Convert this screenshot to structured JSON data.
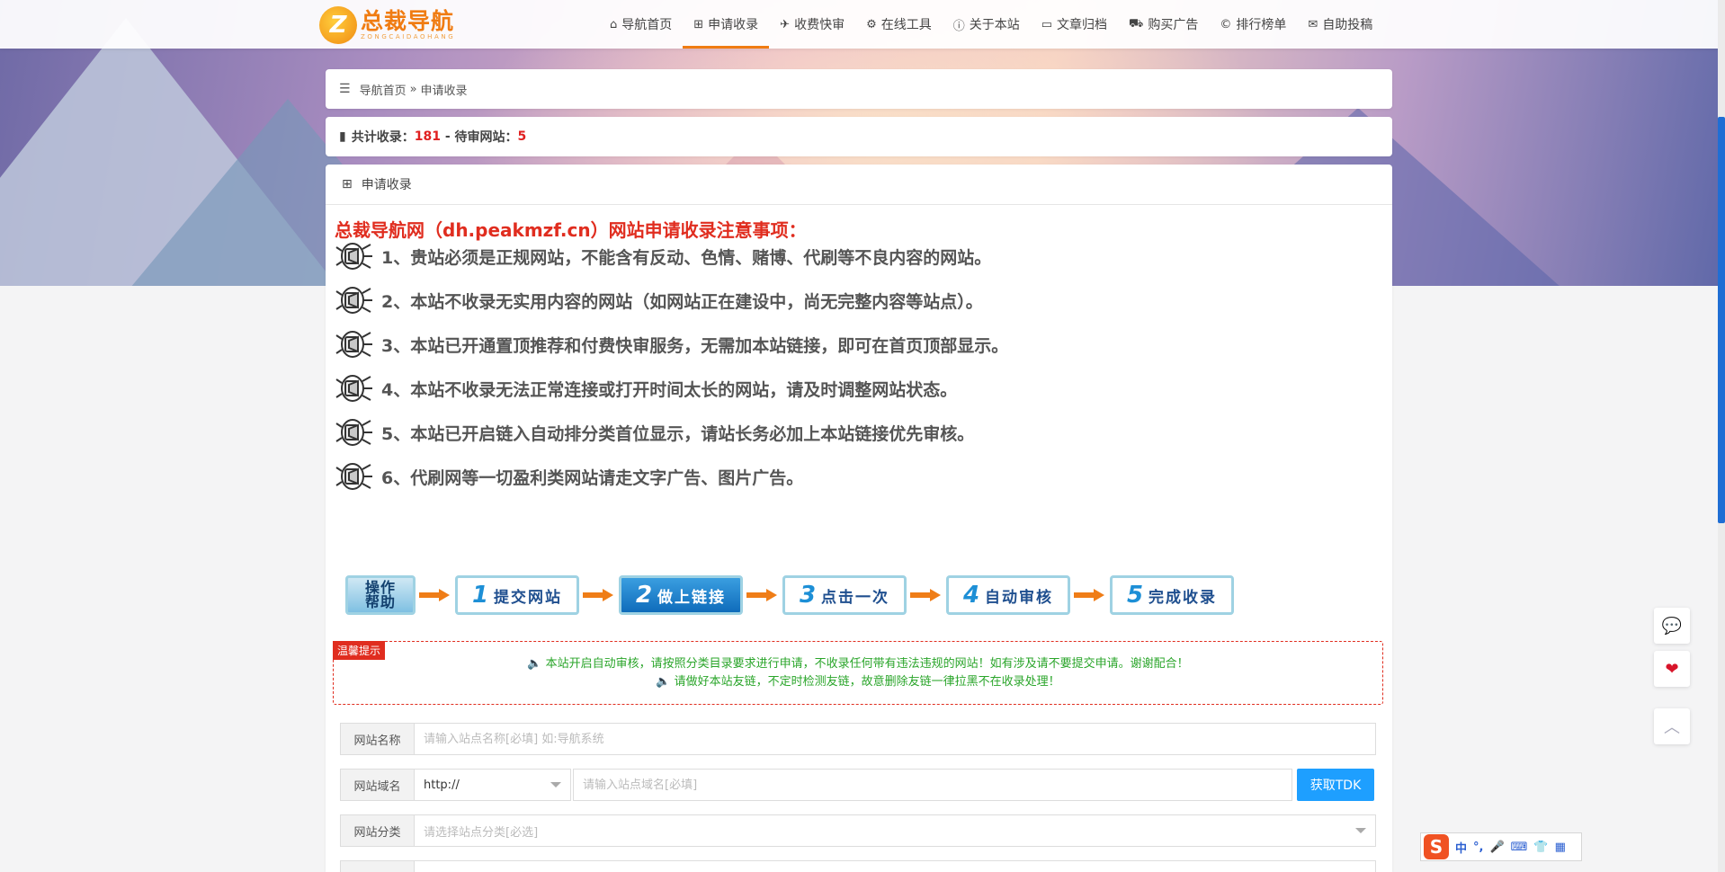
{
  "header": {
    "logo_text": "总裁导航",
    "logo_sub": "ZONGCAIDAOHANG",
    "logo_mark": "Z",
    "nav": [
      {
        "label": "导航首页",
        "icon": "⌂",
        "icon_name": "home-icon"
      },
      {
        "label": "申请收录",
        "icon": "⊞",
        "icon_name": "plus-square-icon",
        "active": true
      },
      {
        "label": "收费快审",
        "icon": "✈",
        "icon_name": "rocket-icon"
      },
      {
        "label": "在线工具",
        "icon": "⚙",
        "icon_name": "gears-icon"
      },
      {
        "label": "关于本站",
        "icon": "ⓘ",
        "icon_name": "info-icon"
      },
      {
        "label": "文章归档",
        "icon": "▭",
        "icon_name": "folder-icon"
      },
      {
        "label": "购买广告",
        "icon": "⛟",
        "icon_name": "cart-icon"
      },
      {
        "label": "排行榜单",
        "icon": "©",
        "icon_name": "copyright-icon"
      },
      {
        "label": "自助投稿",
        "icon": "✉",
        "icon_name": "envelope-icon"
      }
    ],
    "accent_color": "#f07c12"
  },
  "breadcrumb": {
    "home": "导航首页",
    "sep": "»",
    "current": "申请收录"
  },
  "stats": {
    "total_label": "共计收录：",
    "total_value": "181",
    "sep": " - ",
    "pending_label": "待审网站：",
    "pending_value": "5"
  },
  "panel": {
    "title": "申请收录",
    "notice_title": "总裁导航网（dh.peakmzf.cn）网站申请收录注意事项：",
    "rules": [
      "1、贵站必须是正规网站，不能含有反动、色情、赌博、代刷等不良内容的网站。",
      "2、本站不收录无实用内容的网站（如网站正在建设中，尚无完整内容等站点）。",
      "3、本站已开通置顶推荐和付费快审服务，无需加本站链接，即可在首页顶部显示。",
      "4、本站不收录无法正常连接或打开时间太长的网站，请及时调整网站状态。",
      "5、本站已开启链入自动排分类首位显示，请站长务必加上本站链接优先审核。",
      "6、代刷网等一切盈利类网站请走文字广告、图片广告。"
    ],
    "steps": {
      "help": "操作帮助",
      "items": [
        {
          "num": "1",
          "label": "提交网站"
        },
        {
          "num": "2",
          "label": "做上链接",
          "active": true
        },
        {
          "num": "3",
          "label": "点击一次"
        },
        {
          "num": "4",
          "label": "自动审核"
        },
        {
          "num": "5",
          "label": "完成收录"
        }
      ]
    },
    "tip": {
      "tag": "温馨提示",
      "lines": [
        "本站开启自动审核，请按照分类目录要求进行申请，不收录任何带有违法违规的网站！如有涉及请不要提交申请。谢谢配合！",
        "请做好本站友链，不定时检测友链，故意删除友链一律拉黑不在收录处理！"
      ]
    },
    "form": {
      "name_label": "网站名称",
      "name_placeholder": "请输入站点名称[必填] 如:导航系统",
      "domain_label": "网站域名",
      "protocol": "http://",
      "domain_placeholder": "请输入站点域名[必填]",
      "tdk_button": "获取TDK",
      "category_label": "网站分类",
      "category_placeholder": "请选择站点分类[必选]",
      "button_color": "#1e9fff"
    }
  },
  "ime": {
    "logo": "S",
    "mode": "中"
  },
  "colors": {
    "red": "#e02d1f",
    "green": "#2aa52a",
    "scroll_thumb": "#1f6ed4"
  }
}
